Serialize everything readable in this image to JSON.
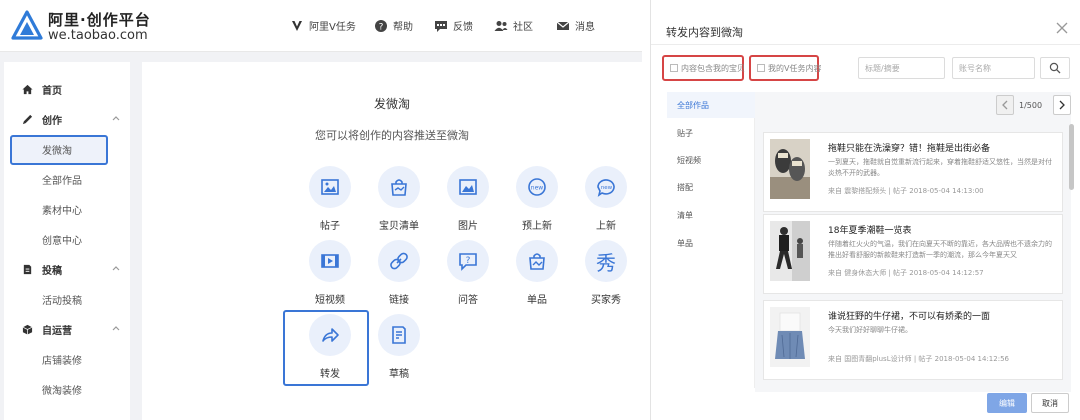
{
  "header": {
    "brand_title": "阿里·创作平台",
    "brand_url": "we.taobao.com",
    "nav": [
      {
        "label": "阿里V任务",
        "icon": "v-task-icon"
      },
      {
        "label": "帮助",
        "icon": "help-icon"
      },
      {
        "label": "反馈",
        "icon": "feedback-icon"
      },
      {
        "label": "社区",
        "icon": "community-icon"
      },
      {
        "label": "消息",
        "icon": "message-icon"
      }
    ]
  },
  "sidebar": {
    "sections": [
      {
        "label": "首页",
        "icon": "home-icon"
      },
      {
        "label": "创作",
        "icon": "pen-icon",
        "items": [
          "发微淘",
          "全部作品",
          "素材中心",
          "创意中心"
        ]
      },
      {
        "label": "投稿",
        "icon": "document-icon",
        "items": [
          "活动投稿"
        ]
      },
      {
        "label": "自运营",
        "icon": "box-icon",
        "items": [
          "店铺装修",
          "微淘装修"
        ]
      }
    ],
    "active_item": "发微淘"
  },
  "content": {
    "title": "发微淘",
    "subtitle": "您可以将创作的内容推送至微淘",
    "options": [
      {
        "label": "帖子",
        "icon": "image-icon"
      },
      {
        "label": "宝贝清单",
        "icon": "shopping-bag-icon"
      },
      {
        "label": "图片",
        "icon": "picture-icon"
      },
      {
        "label": "预上新",
        "icon": "new-badge-icon"
      },
      {
        "label": "上新",
        "icon": "new-chat-icon"
      },
      {
        "label": "短视频",
        "icon": "video-icon"
      },
      {
        "label": "链接",
        "icon": "link-icon"
      },
      {
        "label": "问答",
        "icon": "question-icon"
      },
      {
        "label": "单品",
        "icon": "product-icon"
      },
      {
        "label": "买家秀",
        "icon": "show-icon"
      },
      {
        "label": "转发",
        "icon": "share-icon"
      },
      {
        "label": "草稿",
        "icon": "draft-icon"
      }
    ],
    "show_glyph": "秀",
    "highlighted_option": "转发"
  },
  "modal": {
    "title": "转发内容到微淘",
    "filters": [
      "内容包含我的宝贝",
      "我的V任务内容"
    ],
    "search_title_placeholder": "标题/摘要",
    "search_account_placeholder": "账号名称",
    "categories": [
      "全部作品",
      "贴子",
      "短视频",
      "搭配",
      "清单",
      "单品"
    ],
    "active_category": "全部作品",
    "pager": {
      "current": "1",
      "total": "/500"
    },
    "cards": [
      {
        "title": "拖鞋只能在洗澡穿？错！拖鞋是出街必备",
        "desc": "一到夏天，拖鞋就自觉重新流行起来，穿着拖鞋舒适又悠性，当然是对付炎热不开的武器。",
        "meta": "来自 震黎搭配频头 | 帖子 2018-05-04 14:13:00"
      },
      {
        "title": "18年夏季潮鞋一览表",
        "desc": "伴随着红火火的气温，我们在向夏天不断的靠近，各大品牌也不遗余力的推出好看舒服的新款鞋来打造新一季的潮流，那么今年夏天又",
        "meta": "来自 健身休态大师 | 帖子 2018-05-04 14:12:57"
      },
      {
        "title": "谁说狂野的牛仔裙，不可以有娇柔的一面",
        "desc": "今天我们好好聊聊牛仔裙。",
        "meta": "来自 国图青翻plusL设计师 | 帖子 2018-05-04 14:12:56"
      }
    ],
    "buttons": {
      "edit": "编辑",
      "cancel": "取消"
    }
  },
  "colors": {
    "accent": "#3a76d6",
    "highlight_red": "#d64545",
    "icon_bg": "#eaf0fb"
  }
}
